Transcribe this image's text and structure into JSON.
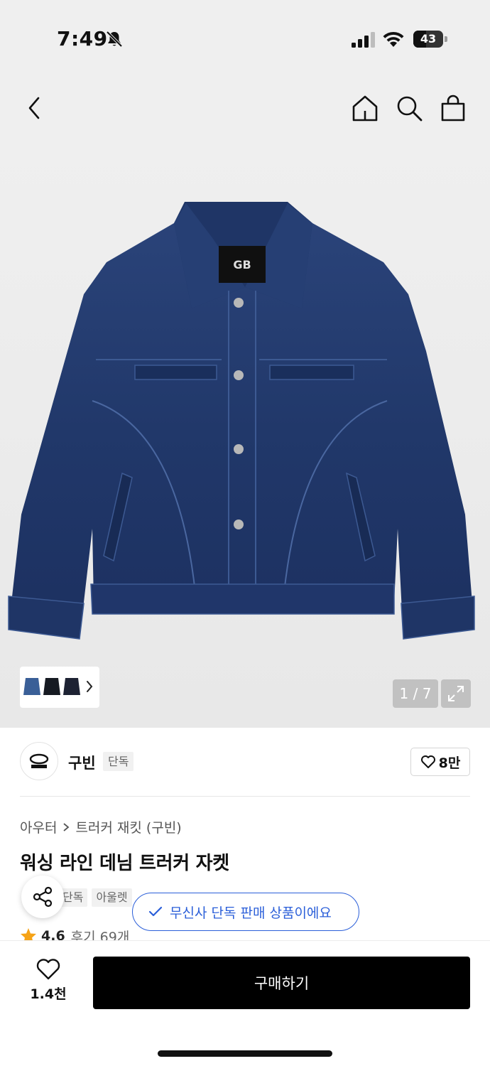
{
  "status_bar": {
    "time": "7:49",
    "battery": "43",
    "icons": [
      "bell-slash-icon",
      "cellular-signal-icon",
      "wifi-icon",
      "battery-icon"
    ]
  },
  "nav": {
    "icons": [
      "back-icon",
      "home-icon",
      "search-icon",
      "shopping-bag-icon"
    ]
  },
  "gallery": {
    "counter": "1 / 7",
    "icons": [
      "chevron-right-icon",
      "expand-icon"
    ]
  },
  "brand": {
    "name": "구빈",
    "badge": "단독",
    "likes": "8만",
    "icons": [
      "brand-logo",
      "heart-outline-icon"
    ]
  },
  "product": {
    "breadcrumb": [
      "아우터",
      "트러커 재킷 (구빈)"
    ],
    "title": "워싱 라인 데님 트러커 자켓",
    "tags": [
      "단독",
      "아울렛"
    ],
    "exclusive_message": "무신사 단독 판매 상품이에요",
    "rating": "4.6",
    "reviews": "후기 69개",
    "icons": [
      "share-icon",
      "check-icon",
      "star-icon"
    ]
  },
  "bottom_bar": {
    "wish_count": "1.4천",
    "buy_label": "구매하기",
    "icons": [
      "heart-outline-icon"
    ]
  },
  "colors": {
    "accent_blue": "#2b5fd9",
    "star": "#f6a317",
    "denim": "#22386b",
    "buy_button": "#000000"
  }
}
